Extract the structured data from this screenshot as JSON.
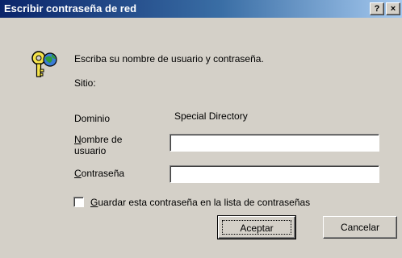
{
  "window": {
    "title": "Escribir contraseña de red",
    "help_label": "?",
    "close_label": "×"
  },
  "dialog": {
    "icon": "keys-icon",
    "prompt": "Escriba su nombre de usuario y contraseña.",
    "site_label": "Sitio:",
    "domain_label": "Dominio",
    "domain_value": "Special Directory",
    "username_label_line1_first": "N",
    "username_label_line1_rest": "ombre de",
    "username_label_line2": "usuario",
    "username_value": "",
    "password_label_first": "C",
    "password_label_rest": "ontraseña",
    "password_value": "",
    "save_password_first": "G",
    "save_password_rest": "uardar esta contraseña en la lista de contraseñas",
    "save_password_checked": false
  },
  "buttons": {
    "ok_label": "Aceptar",
    "cancel_label": "Cancelar"
  },
  "colors": {
    "title_start": "#0a246a",
    "title_end": "#a6caf0",
    "face": "#d4d0c8"
  }
}
